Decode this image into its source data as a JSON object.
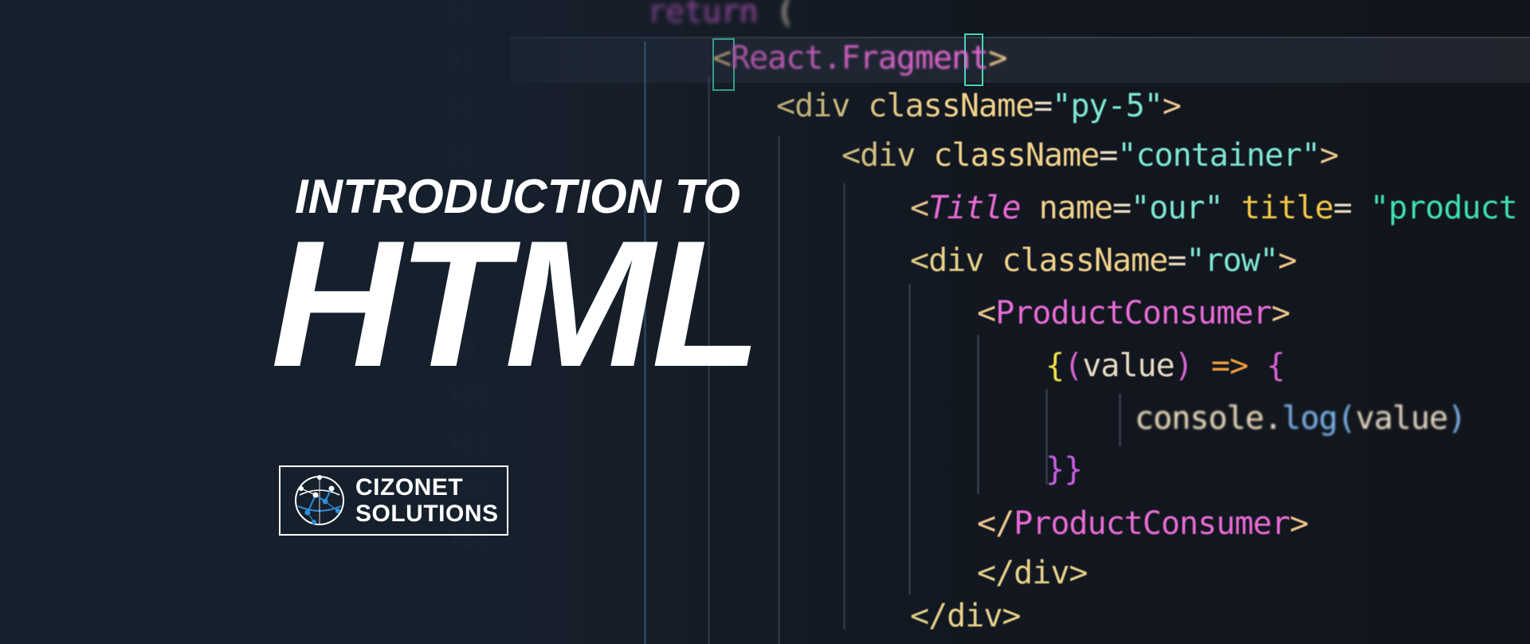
{
  "headline": {
    "intro": "INTRODUCTION TO",
    "title": "HTML"
  },
  "brand": {
    "line1": "CIZONET",
    "line2": "SOLUTIONS",
    "icon": "network-globe-icon",
    "accent": "#2e8fd8"
  },
  "gutter": {
    "numbers": [
      "92",
      "93",
      "94",
      "95",
      "96",
      "97",
      "98",
      "99",
      "100",
      "101",
      "102",
      "103"
    ]
  },
  "code": {
    "line_return": {
      "kw": "return",
      "paren": "("
    },
    "line_fragment": {
      "open": "<",
      "name": "React.Fragment",
      "close": ">"
    },
    "line_div1": {
      "open": "<div ",
      "attr": "className",
      "eq": "=",
      "val": "\"py-5\"",
      "close": ">"
    },
    "line_div2": {
      "open": "<div ",
      "attr": "className",
      "eq": "=",
      "val": "\"container\"",
      "close": ">"
    },
    "line_title": {
      "open": "<",
      "comp": "Title",
      "attr1": " name",
      "eq1": "=",
      "val1": "\"our\"",
      "attr2": " title",
      "eq2": "= ",
      "val2": "\"product"
    },
    "line_div3": {
      "open": "<div ",
      "attr": "className",
      "eq": "=",
      "val": "\"row\"",
      "close": ">"
    },
    "line_consumer": {
      "open": "<",
      "comp": "ProductConsumer",
      "close": ">"
    },
    "line_arrow": {
      "brace": "{",
      "paren_open": "(",
      "arg": "value",
      "paren_close": ")",
      "arrow": " => ",
      "brace2": "{"
    },
    "line_console": {
      "obj": "console.",
      "fn": "log",
      "paren_open": "(",
      "arg": "value",
      "paren_close": ")"
    },
    "line_close_braces": {
      "text": "}}"
    },
    "line_close_consumer": {
      "open": "</",
      "comp": "ProductConsumer",
      "close": ">"
    },
    "line_close_div1": {
      "text": "</div>"
    },
    "line_close_div2": {
      "text": "</div>"
    }
  }
}
